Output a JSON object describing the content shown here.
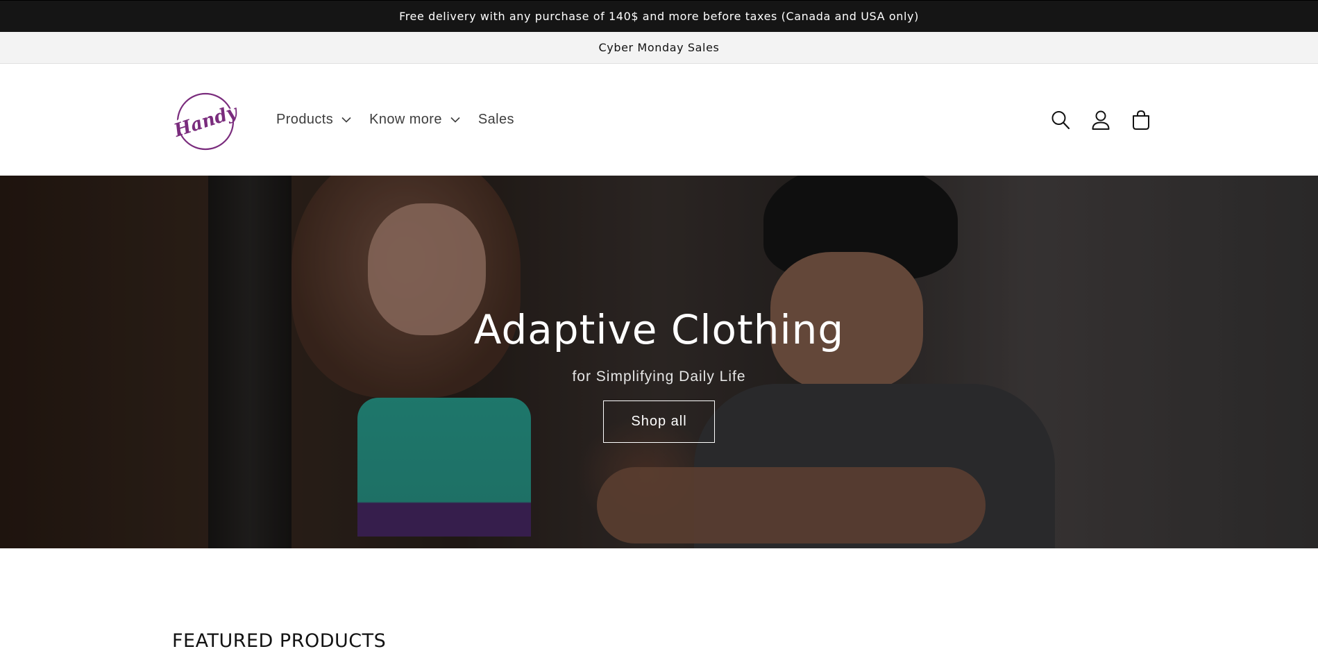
{
  "announcement": {
    "primary": "Free delivery with any purchase of 140$ and more before taxes (Canada and USA only)",
    "secondary": "Cyber Monday Sales"
  },
  "header": {
    "logo_text": "Handy",
    "nav": [
      {
        "label": "Products",
        "has_dropdown": true
      },
      {
        "label": "Know more",
        "has_dropdown": true
      },
      {
        "label": "Sales",
        "has_dropdown": false
      }
    ],
    "icons": [
      "search-icon",
      "account-icon",
      "cart-icon"
    ]
  },
  "hero": {
    "title": "Adaptive Clothing",
    "subtitle": "for Simplifying Daily Life",
    "button_label": "Shop all"
  },
  "featured": {
    "title": "FEATURED PRODUCTS"
  },
  "colors": {
    "announcement_dark": "#151515",
    "announcement_light": "#f3f3f3",
    "logo_purple": "#7a2c7d"
  }
}
